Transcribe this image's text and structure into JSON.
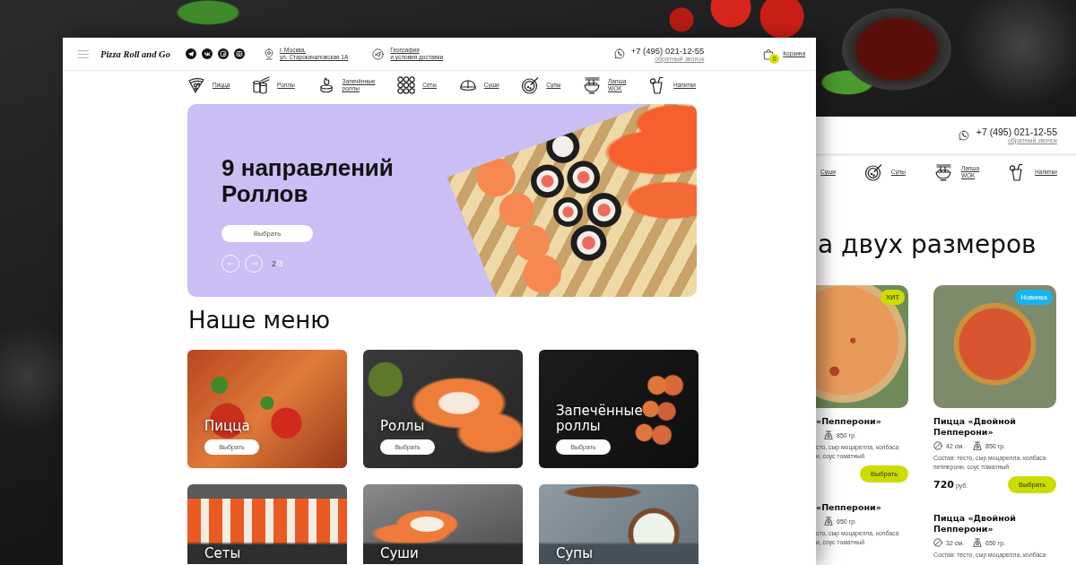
{
  "front_page": {
    "header": {
      "logo": "Pizza Roll and Go",
      "address_lines": [
        "г. Москва,",
        "ул. Старокачаловская 1А"
      ],
      "delivery_lines": [
        "География",
        "и условия доставки"
      ],
      "phone": "+7 (495) 021-12-55",
      "callback": "обратный звонок",
      "cart_count": "0",
      "cart_label": "Корзина"
    },
    "nav": [
      {
        "label": "Пицца"
      },
      {
        "label": "Роллы"
      },
      {
        "label": "Запечённые роллы"
      },
      {
        "label": "Сеты"
      },
      {
        "label": "Суши"
      },
      {
        "label": "Супы"
      },
      {
        "label": "Лапша WOK"
      },
      {
        "label": "Напитки"
      }
    ],
    "banner": {
      "title": "9 направлений Роллов",
      "button": "Выбрать",
      "slide_current": "2",
      "slide_separator": "/",
      "slide_total": "3"
    },
    "menu_heading": "Наше меню",
    "menu_cards": [
      {
        "title": "Пицца",
        "button": "Выбрать"
      },
      {
        "title": "Роллы",
        "button": "Выбрать"
      },
      {
        "title": "Запечённые роллы",
        "button": "Выбрать"
      },
      {
        "title": "Сеты"
      },
      {
        "title": "Суши"
      },
      {
        "title": "Супы"
      }
    ]
  },
  "back_page": {
    "header": {
      "phone": "+7 (495) 021-12-55",
      "callback": "обратный звонок"
    },
    "nav": [
      {
        "label": "Суши"
      },
      {
        "label": "Супы"
      },
      {
        "label": "Лапша WOK"
      },
      {
        "label": "Напитки"
      }
    ],
    "heading": "а двух размеров",
    "products": [
      {
        "badge": {
          "label": "ХИТ",
          "color": "#cddc00"
        },
        "variants": [
          {
            "name": "«Пепперони»",
            "weight": "850 гр.",
            "composition_lines": [
              "сто, сыр моцарелла, колбаса",
              "и, соус томатный"
            ],
            "button": "Выбрать"
          },
          {
            "name": "«Пепперони»",
            "weight": "650 гр.",
            "composition_lines": [
              "сто, сыр моцарелла, колбаса",
              "и, соус томатный"
            ]
          }
        ]
      },
      {
        "badge": {
          "label": "Новинка",
          "color": "#19b4f0"
        },
        "variants": [
          {
            "name": "Пицца «Двойной Пепперони»",
            "size": "42 см.",
            "weight": "850 гр.",
            "composition_lines": [
              "Состав: тесто, сыр моцарелла, колбаса",
              "пепперони, соус томатный"
            ],
            "price": "720",
            "currency": "руб.",
            "button": "Выбрать"
          },
          {
            "name": "Пицца «Двойной Пепперони»",
            "size": "32 см.",
            "weight": "650 гр.",
            "composition_lines": [
              "Состав: тесто, сыр моцарелла, колбаса"
            ]
          }
        ]
      }
    ]
  }
}
